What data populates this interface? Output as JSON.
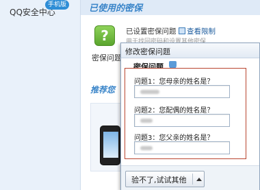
{
  "nav": {
    "title": "QQ安全中心",
    "badge": "手机版"
  },
  "used": {
    "section_title": "已使用的密保",
    "icon_glyph": "?",
    "icon_label": "密保问题",
    "status_text": "已设置密保问题",
    "view_link": "查看限制",
    "description": "用于找回密码和设置其他密保"
  },
  "recommend": {
    "section_title": "推荐您"
  },
  "dialog": {
    "title": "修改密保问题",
    "section_label": "密保问题",
    "questions": [
      {
        "label": "问题1：您母亲的姓名是？"
      },
      {
        "label": "问题2：您配偶的姓名是？"
      },
      {
        "label": "问题3：您父亲的姓名是？"
      }
    ],
    "switch_button": "验不了,试试其他"
  },
  "colors": {
    "accent": "#3a85c9",
    "panel_border": "#b8442e",
    "icon_green": "#6db33f"
  }
}
